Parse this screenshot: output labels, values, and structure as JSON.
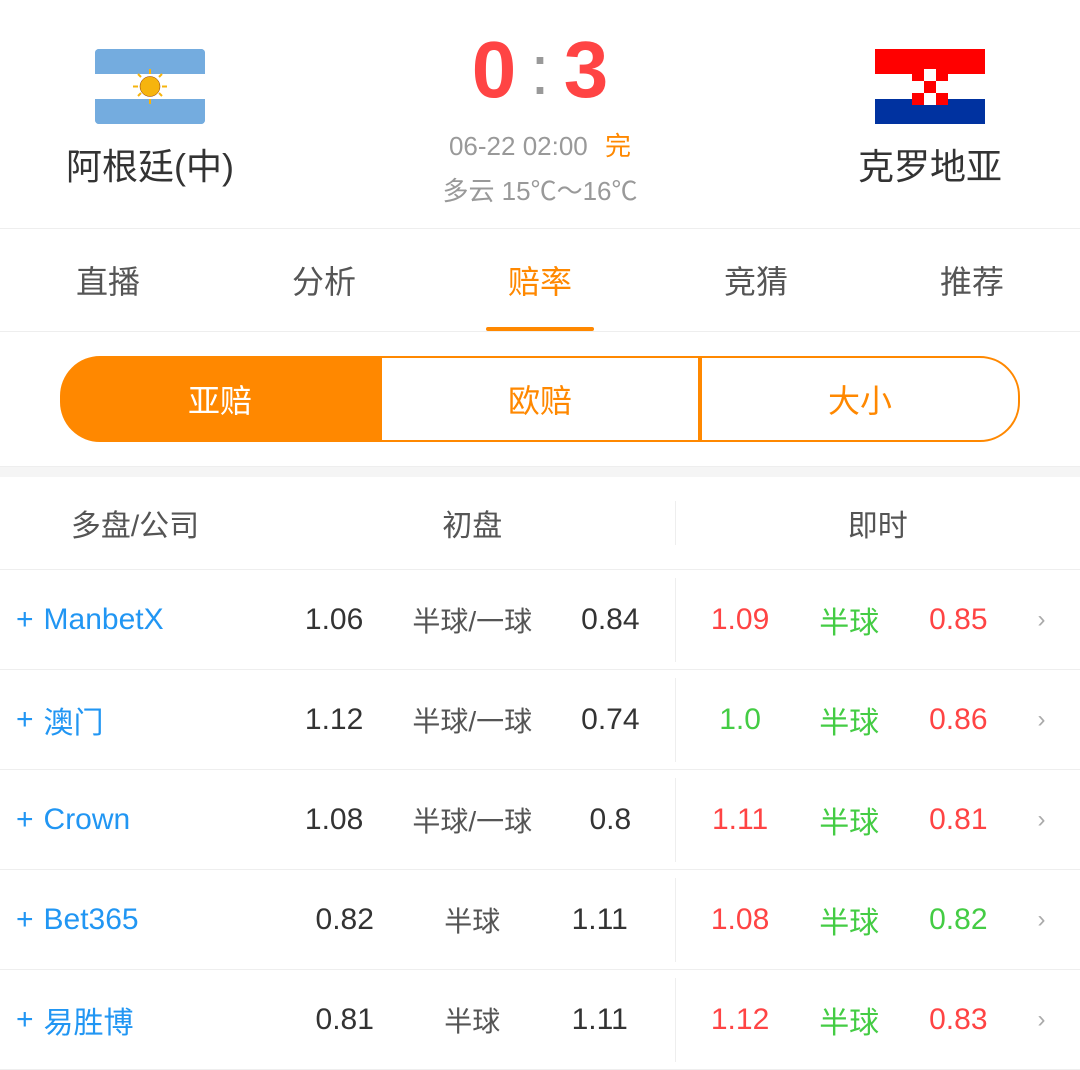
{
  "header": {
    "team_left": {
      "name": "阿根廷(中)",
      "flag": "argentina"
    },
    "score_left": "0",
    "score_right": "3",
    "colon": ":",
    "team_right": {
      "name": "克罗地亚",
      "flag": "croatia"
    },
    "match_time": "06-22 02:00",
    "match_status": "完",
    "weather": "多云  15℃～16℃"
  },
  "nav_tabs": [
    {
      "label": "直播",
      "active": false
    },
    {
      "label": "分析",
      "active": false
    },
    {
      "label": "赔率",
      "active": true
    },
    {
      "label": "竞猜",
      "active": false
    },
    {
      "label": "推荐",
      "active": false
    }
  ],
  "sub_tabs": [
    {
      "label": "亚赔",
      "active": true
    },
    {
      "label": "欧赔",
      "active": false
    },
    {
      "label": "大小",
      "active": false
    }
  ],
  "table": {
    "header": {
      "company_col": "多盘/公司",
      "initial_col": "初盘",
      "realtime_col": "即时"
    },
    "rows": [
      {
        "company": "ManbetX",
        "initial_left": "1.06",
        "initial_mid": "半球/一球",
        "initial_right": "0.84",
        "rt_left": "1.09",
        "rt_left_color": "red",
        "rt_mid": "半球",
        "rt_mid_color": "green",
        "rt_right": "0.85",
        "rt_right_color": "red"
      },
      {
        "company": "澳门",
        "initial_left": "1.12",
        "initial_mid": "半球/一球",
        "initial_right": "0.74",
        "rt_left": "1.0",
        "rt_left_color": "green",
        "rt_mid": "半球",
        "rt_mid_color": "green",
        "rt_right": "0.86",
        "rt_right_color": "red"
      },
      {
        "company": "Crown",
        "initial_left": "1.08",
        "initial_mid": "半球/一球",
        "initial_right": "0.8",
        "rt_left": "1.11",
        "rt_left_color": "red",
        "rt_mid": "半球",
        "rt_mid_color": "green",
        "rt_right": "0.81",
        "rt_right_color": "red"
      },
      {
        "company": "Bet365",
        "initial_left": "0.82",
        "initial_mid": "半球",
        "initial_right": "1.11",
        "rt_left": "1.08",
        "rt_left_color": "red",
        "rt_mid": "半球",
        "rt_mid_color": "green",
        "rt_right": "0.82",
        "rt_right_color": "green"
      },
      {
        "company": "易胜博",
        "initial_left": "0.81",
        "initial_mid": "半球",
        "initial_right": "1.11",
        "rt_left": "1.12",
        "rt_left_color": "red",
        "rt_mid": "半球",
        "rt_mid_color": "green",
        "rt_right": "0.83",
        "rt_right_color": "red"
      }
    ]
  }
}
